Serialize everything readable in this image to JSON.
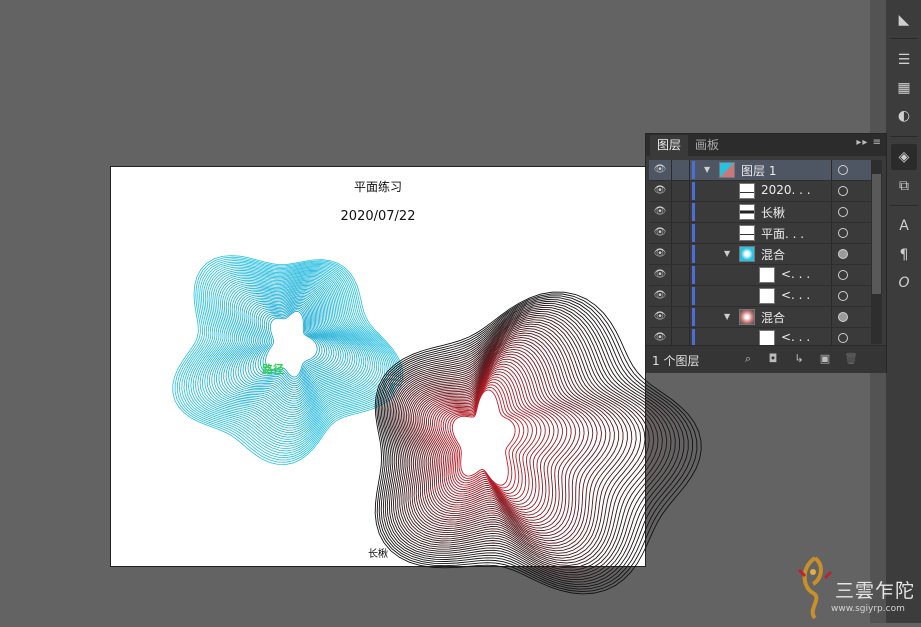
{
  "artboard": {
    "title": "平面练习",
    "date": "2020/07/22",
    "label_blue": "路径",
    "author": "长楸"
  },
  "layers_panel": {
    "tabs": [
      "图层",
      "画板"
    ],
    "menu_glyph": "▸▸ ≡",
    "rows": [
      {
        "name": "图层 1",
        "expanded": true,
        "target": "hollow",
        "selected": true
      },
      {
        "name": "2020. . .",
        "target": "hollow"
      },
      {
        "name": "长楸",
        "target": "hollow"
      },
      {
        "name": "平面. . .",
        "target": "hollow"
      },
      {
        "name": "混合",
        "expanded": true,
        "target": "filled"
      },
      {
        "name": "<. . .",
        "target": "hollow"
      },
      {
        "name": "<. . .",
        "target": "hollow"
      },
      {
        "name": "混合",
        "expanded": true,
        "target": "filled"
      },
      {
        "name": "<. . .",
        "target": "hollow"
      }
    ],
    "footer": {
      "layer_count": "1 个图层"
    }
  },
  "tool_strip": {
    "icons": [
      "gradient-panel-icon",
      "stroke-lines-icon",
      "gradient-swatch-icon",
      "transparency-icon",
      "layers-icon",
      "artboards-icon",
      "character-icon",
      "paragraph-icon",
      "opentype-icon"
    ]
  },
  "watermark": {
    "title": "三雲乍陀",
    "url": "www.sgiyrp.com"
  },
  "colors": {
    "canvas_bg": "#636363",
    "blend_blue": "#25c0e0",
    "blend_red": "#c21f2a",
    "layer_color": "#4c6fd6",
    "selected_row": "#4e5563"
  }
}
